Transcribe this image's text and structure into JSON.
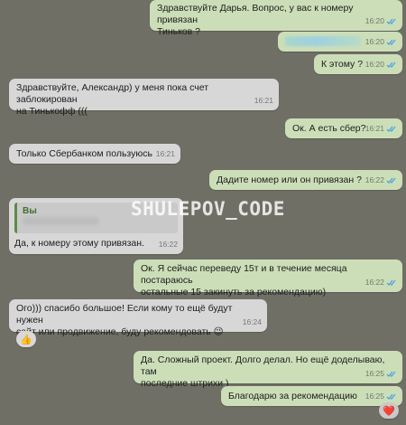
{
  "messages": [
    {
      "text_1": "Здравствуйте Дарья. Вопрос, у вас к номеру привязан",
      "text_2": "Тиньков ?",
      "time": "16:20"
    },
    {
      "time": "16:20"
    },
    {
      "text": "К этому ?",
      "time": "16:20"
    },
    {
      "text_1": "Здравствуйте, Александр) у меня пока счет заблокирован",
      "text_2": "на Тинькофф (((",
      "time": "16:21"
    },
    {
      "text": "Ок. А есть сбер?",
      "time": "16:21"
    },
    {
      "text": "Только Сбербанком пользуюсь",
      "time": "16:21"
    },
    {
      "text": "Дадите номер или он привязан ?",
      "time": "16:22"
    },
    {
      "quote_name": "Вы",
      "text": "Да, к номеру этому привязан.",
      "time": "16:22"
    },
    {
      "text_1": "Ок. Я сейчас переведу 15т и в течение  месяца постараюсь",
      "text_2": "остальные 15 закинуть за рекомендацию)",
      "time": "16:22"
    },
    {
      "text_1": "Ого))) спасибо большое! Если кому то ещё будут нужен",
      "text_2": "сайт или продвижение, буду рекомендовать 😉",
      "time": "16:24",
      "reaction": "👍"
    },
    {
      "text_1": "Да. Сложный проект. Долго делал. Но ещё доделываю, там",
      "text_2": "последние штрихи )",
      "time": "16:25"
    },
    {
      "text": "Благодарю за рекомендацию",
      "time": "16:25",
      "reaction": "❤️"
    }
  ],
  "watermark": "SHULEPOV_CODE",
  "colors": {
    "outgoing": "#ccdeb8",
    "incoming": "#d7d7d7",
    "check": "#4fa3e0"
  }
}
